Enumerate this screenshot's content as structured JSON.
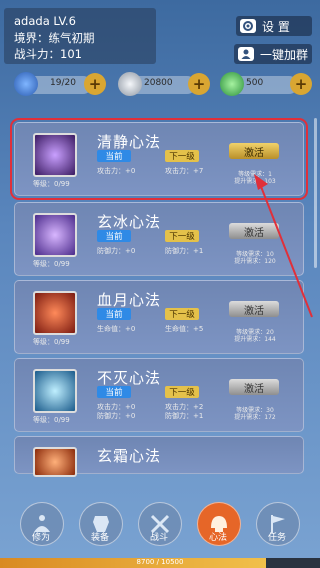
{
  "header": {
    "name_level": "adada LV.6",
    "realm": "境界：练气初期",
    "power": "战斗力：101"
  },
  "top_buttons": {
    "settings": "设 置",
    "join_group": "一键加群"
  },
  "resources": [
    {
      "icon": "stamina-icon",
      "value": "19/20",
      "color": "#3f7fd6"
    },
    {
      "icon": "silver-coin-icon",
      "value": "20800",
      "color": "#cdd3da"
    },
    {
      "icon": "jade-icon",
      "value": "500",
      "color": "#3fbf53"
    }
  ],
  "cards": [
    {
      "title": "清静心法",
      "current": "当前",
      "next": "下一级",
      "cur_stat1": "攻击力：+0",
      "next_stat1": "攻击力：+7",
      "cur_stat2": "",
      "next_stat2": "",
      "level": "等级：0/99",
      "action": "激活",
      "req1": "等级需求：1",
      "req2": "提升需求：103",
      "style": "gold"
    },
    {
      "title": "玄冰心法",
      "current": "当前",
      "next": "下一级",
      "cur_stat1": "防御力：+0",
      "next_stat1": "防御力：+1",
      "cur_stat2": "",
      "next_stat2": "",
      "level": "等级：0/99",
      "action": "激活",
      "req1": "等级需求：10",
      "req2": "提升需求：120",
      "style": "grey"
    },
    {
      "title": "血月心法",
      "current": "当前",
      "next": "下一级",
      "cur_stat1": "生命值：+0",
      "next_stat1": "生命值：+5",
      "cur_stat2": "",
      "next_stat2": "",
      "level": "等级：0/99",
      "action": "激活",
      "req1": "等级需求：20",
      "req2": "提升需求：144",
      "style": "grey"
    },
    {
      "title": "不灭心法",
      "current": "当前",
      "next": "下一级",
      "cur_stat1": "攻击力：+0",
      "next_stat1": "攻击力：+2",
      "cur_stat2": "防御力：+0",
      "next_stat2": "防御力：+1",
      "level": "等级：0/99",
      "action": "激活",
      "req1": "等级需求：30",
      "req2": "提升需求：172",
      "style": "grey"
    },
    {
      "title": "玄霜心法"
    }
  ],
  "nav": [
    {
      "label": "修为",
      "icon": "meditate-icon"
    },
    {
      "label": "装备",
      "icon": "armor-icon"
    },
    {
      "label": "战斗",
      "icon": "swords-icon"
    },
    {
      "label": "心法",
      "icon": "helmet-icon"
    },
    {
      "label": "任务",
      "icon": "flag-icon"
    }
  ],
  "xp": {
    "text": "8700 / 10500",
    "progress": 0.83
  }
}
